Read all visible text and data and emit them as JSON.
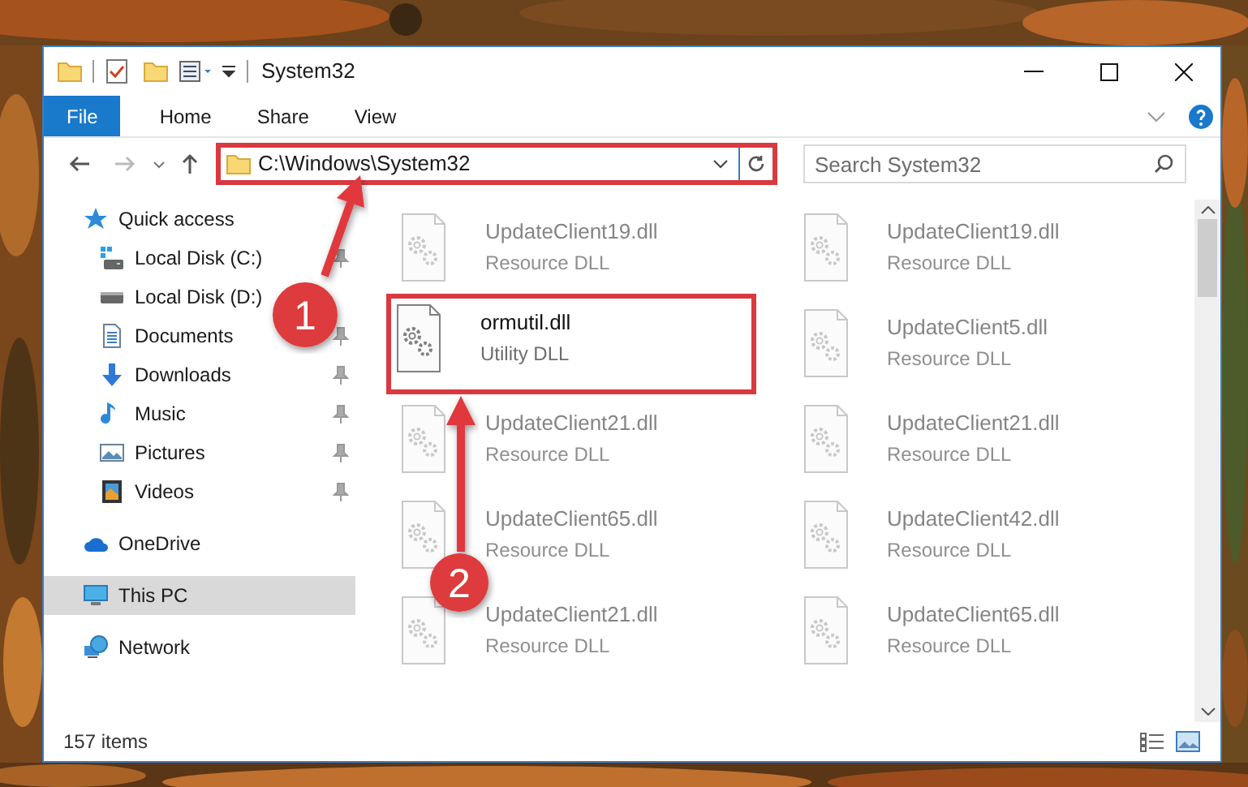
{
  "window": {
    "title": "System32"
  },
  "ribbon": {
    "tabs": [
      {
        "label": "File",
        "kind": "file"
      },
      {
        "label": "Home",
        "kind": "tab"
      },
      {
        "label": "Share",
        "kind": "tab"
      },
      {
        "label": "View",
        "kind": "tab"
      }
    ]
  },
  "address_bar": {
    "path": "C:\\Windows\\System32",
    "highlighted": true
  },
  "search": {
    "placeholder": "Search System32"
  },
  "sidebar": {
    "items": [
      {
        "label": "Quick access",
        "kind": "star",
        "selected": false,
        "children": [
          {
            "label": "Local Disk (C:)",
            "kind": "windisk",
            "pinned": true
          },
          {
            "label": "Local Disk (D:)",
            "kind": "disk",
            "pinned": false
          },
          {
            "label": "Documents",
            "kind": "documents",
            "pinned": true
          },
          {
            "label": "Downloads",
            "kind": "downloads",
            "pinned": true
          },
          {
            "label": "Music",
            "kind": "music",
            "pinned": true
          },
          {
            "label": "Pictures",
            "kind": "pictures",
            "pinned": true
          },
          {
            "label": "Videos",
            "kind": "videos",
            "pinned": true
          }
        ]
      },
      {
        "label": "OneDrive",
        "kind": "cloud",
        "selected": false
      },
      {
        "label": "This PC",
        "kind": "pc",
        "selected": true
      },
      {
        "label": "Network",
        "kind": "network",
        "selected": false
      }
    ]
  },
  "files": [
    {
      "name": "UpdateClient19.dll",
      "type": "Resource DLL",
      "dimmed": true,
      "highlighted": false
    },
    {
      "name": "UpdateClient19.dll",
      "type": "Resource DLL",
      "dimmed": true,
      "highlighted": false
    },
    {
      "name": "ormutil.dll",
      "type": "Utility DLL",
      "dimmed": false,
      "highlighted": true
    },
    {
      "name": "UpdateClient5.dll",
      "type": "Resource DLL",
      "dimmed": true,
      "highlighted": false
    },
    {
      "name": "UpdateClient21.dll",
      "type": "Resource DLL",
      "dimmed": true,
      "highlighted": false
    },
    {
      "name": "UpdateClient21.dll",
      "type": "Resource DLL",
      "dimmed": true,
      "highlighted": false
    },
    {
      "name": "UpdateClient65.dll",
      "type": "Resource DLL",
      "dimmed": true,
      "highlighted": false
    },
    {
      "name": "UpdateClient42.dll",
      "type": "Resource DLL",
      "dimmed": true,
      "highlighted": false
    },
    {
      "name": "UpdateClient21.dll",
      "type": "Resource DLL",
      "dimmed": true,
      "highlighted": false
    },
    {
      "name": "UpdateClient65.dll",
      "type": "Resource DLL",
      "dimmed": true,
      "highlighted": false
    }
  ],
  "status_bar": {
    "item_count": "157 items"
  },
  "callouts": [
    {
      "number": "1"
    },
    {
      "number": "2"
    }
  ]
}
